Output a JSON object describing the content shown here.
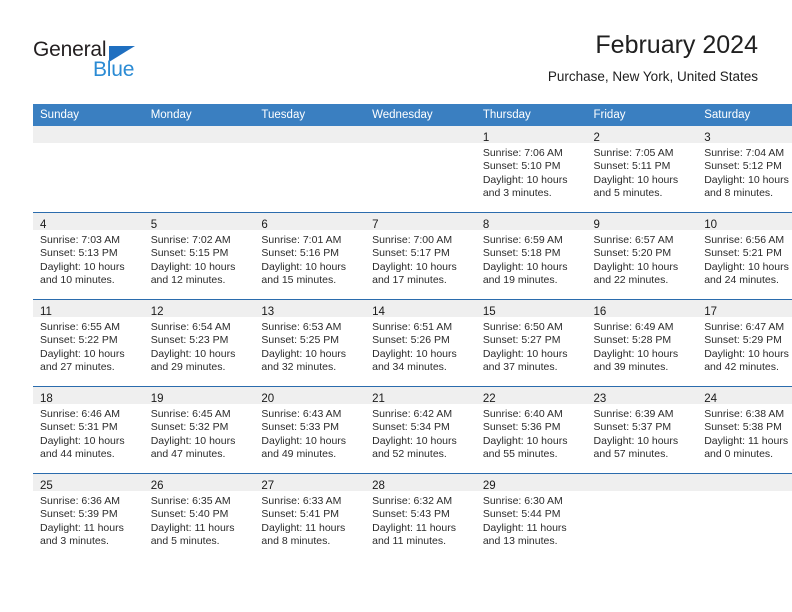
{
  "brand": {
    "name_primary": "General",
    "name_secondary": "Blue",
    "triangle_color": "#1f6fc0",
    "secondary_color": "#2b8bd4"
  },
  "header": {
    "title": "February 2024",
    "subtitle": "Purchase, New York, United States"
  },
  "theme": {
    "header_bg": "#3a7fc1",
    "header_text": "#ffffff",
    "row_divider": "#2b6cad",
    "daynum_band": "#efefef",
    "body_text": "#2b2b2b"
  },
  "weekday_headers": [
    "Sunday",
    "Monday",
    "Tuesday",
    "Wednesday",
    "Thursday",
    "Friday",
    "Saturday"
  ],
  "weeks": [
    [
      {
        "day": "",
        "lines": []
      },
      {
        "day": "",
        "lines": []
      },
      {
        "day": "",
        "lines": []
      },
      {
        "day": "",
        "lines": []
      },
      {
        "day": "1",
        "lines": [
          "Sunrise: 7:06 AM",
          "Sunset: 5:10 PM",
          "Daylight: 10 hours",
          "and 3 minutes."
        ]
      },
      {
        "day": "2",
        "lines": [
          "Sunrise: 7:05 AM",
          "Sunset: 5:11 PM",
          "Daylight: 10 hours",
          "and 5 minutes."
        ]
      },
      {
        "day": "3",
        "lines": [
          "Sunrise: 7:04 AM",
          "Sunset: 5:12 PM",
          "Daylight: 10 hours",
          "and 8 minutes."
        ]
      }
    ],
    [
      {
        "day": "4",
        "lines": [
          "Sunrise: 7:03 AM",
          "Sunset: 5:13 PM",
          "Daylight: 10 hours",
          "and 10 minutes."
        ]
      },
      {
        "day": "5",
        "lines": [
          "Sunrise: 7:02 AM",
          "Sunset: 5:15 PM",
          "Daylight: 10 hours",
          "and 12 minutes."
        ]
      },
      {
        "day": "6",
        "lines": [
          "Sunrise: 7:01 AM",
          "Sunset: 5:16 PM",
          "Daylight: 10 hours",
          "and 15 minutes."
        ]
      },
      {
        "day": "7",
        "lines": [
          "Sunrise: 7:00 AM",
          "Sunset: 5:17 PM",
          "Daylight: 10 hours",
          "and 17 minutes."
        ]
      },
      {
        "day": "8",
        "lines": [
          "Sunrise: 6:59 AM",
          "Sunset: 5:18 PM",
          "Daylight: 10 hours",
          "and 19 minutes."
        ]
      },
      {
        "day": "9",
        "lines": [
          "Sunrise: 6:57 AM",
          "Sunset: 5:20 PM",
          "Daylight: 10 hours",
          "and 22 minutes."
        ]
      },
      {
        "day": "10",
        "lines": [
          "Sunrise: 6:56 AM",
          "Sunset: 5:21 PM",
          "Daylight: 10 hours",
          "and 24 minutes."
        ]
      }
    ],
    [
      {
        "day": "11",
        "lines": [
          "Sunrise: 6:55 AM",
          "Sunset: 5:22 PM",
          "Daylight: 10 hours",
          "and 27 minutes."
        ]
      },
      {
        "day": "12",
        "lines": [
          "Sunrise: 6:54 AM",
          "Sunset: 5:23 PM",
          "Daylight: 10 hours",
          "and 29 minutes."
        ]
      },
      {
        "day": "13",
        "lines": [
          "Sunrise: 6:53 AM",
          "Sunset: 5:25 PM",
          "Daylight: 10 hours",
          "and 32 minutes."
        ]
      },
      {
        "day": "14",
        "lines": [
          "Sunrise: 6:51 AM",
          "Sunset: 5:26 PM",
          "Daylight: 10 hours",
          "and 34 minutes."
        ]
      },
      {
        "day": "15",
        "lines": [
          "Sunrise: 6:50 AM",
          "Sunset: 5:27 PM",
          "Daylight: 10 hours",
          "and 37 minutes."
        ]
      },
      {
        "day": "16",
        "lines": [
          "Sunrise: 6:49 AM",
          "Sunset: 5:28 PM",
          "Daylight: 10 hours",
          "and 39 minutes."
        ]
      },
      {
        "day": "17",
        "lines": [
          "Sunrise: 6:47 AM",
          "Sunset: 5:29 PM",
          "Daylight: 10 hours",
          "and 42 minutes."
        ]
      }
    ],
    [
      {
        "day": "18",
        "lines": [
          "Sunrise: 6:46 AM",
          "Sunset: 5:31 PM",
          "Daylight: 10 hours",
          "and 44 minutes."
        ]
      },
      {
        "day": "19",
        "lines": [
          "Sunrise: 6:45 AM",
          "Sunset: 5:32 PM",
          "Daylight: 10 hours",
          "and 47 minutes."
        ]
      },
      {
        "day": "20",
        "lines": [
          "Sunrise: 6:43 AM",
          "Sunset: 5:33 PM",
          "Daylight: 10 hours",
          "and 49 minutes."
        ]
      },
      {
        "day": "21",
        "lines": [
          "Sunrise: 6:42 AM",
          "Sunset: 5:34 PM",
          "Daylight: 10 hours",
          "and 52 minutes."
        ]
      },
      {
        "day": "22",
        "lines": [
          "Sunrise: 6:40 AM",
          "Sunset: 5:36 PM",
          "Daylight: 10 hours",
          "and 55 minutes."
        ]
      },
      {
        "day": "23",
        "lines": [
          "Sunrise: 6:39 AM",
          "Sunset: 5:37 PM",
          "Daylight: 10 hours",
          "and 57 minutes."
        ]
      },
      {
        "day": "24",
        "lines": [
          "Sunrise: 6:38 AM",
          "Sunset: 5:38 PM",
          "Daylight: 11 hours",
          "and 0 minutes."
        ]
      }
    ],
    [
      {
        "day": "25",
        "lines": [
          "Sunrise: 6:36 AM",
          "Sunset: 5:39 PM",
          "Daylight: 11 hours",
          "and 3 minutes."
        ]
      },
      {
        "day": "26",
        "lines": [
          "Sunrise: 6:35 AM",
          "Sunset: 5:40 PM",
          "Daylight: 11 hours",
          "and 5 minutes."
        ]
      },
      {
        "day": "27",
        "lines": [
          "Sunrise: 6:33 AM",
          "Sunset: 5:41 PM",
          "Daylight: 11 hours",
          "and 8 minutes."
        ]
      },
      {
        "day": "28",
        "lines": [
          "Sunrise: 6:32 AM",
          "Sunset: 5:43 PM",
          "Daylight: 11 hours",
          "and 11 minutes."
        ]
      },
      {
        "day": "29",
        "lines": [
          "Sunrise: 6:30 AM",
          "Sunset: 5:44 PM",
          "Daylight: 11 hours",
          "and 13 minutes."
        ]
      },
      {
        "day": "",
        "lines": []
      },
      {
        "day": "",
        "lines": []
      }
    ]
  ]
}
